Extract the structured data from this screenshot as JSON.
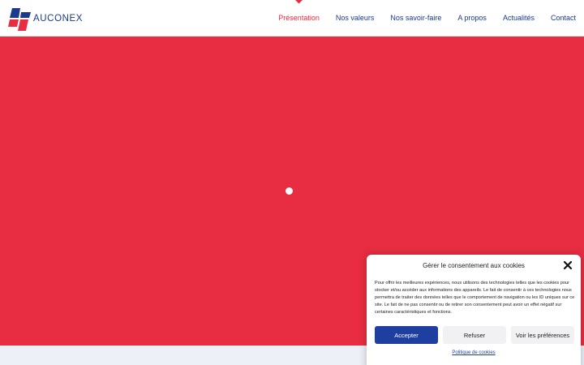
{
  "brand": {
    "name": "AUCONEX",
    "logo_icon": "auconex-logo-icon",
    "primary": "#1b3a8c",
    "accent": "#e82d42"
  },
  "nav": {
    "items": [
      {
        "label": "Présentation",
        "active": true
      },
      {
        "label": "Nos valeurs",
        "active": false
      },
      {
        "label": "Nos savoir-faire",
        "active": false
      },
      {
        "label": "A propos",
        "active": false
      },
      {
        "label": "Actualités",
        "active": false
      },
      {
        "label": "Contact",
        "active": false
      }
    ]
  },
  "hero": {
    "background": "#e82d42",
    "loader_icon": "loading-dot-icon"
  },
  "cookie": {
    "title": "Gérer le consentement aux cookies",
    "close_icon": "close-icon",
    "body": "Pour offrir les meilleures expériences, nous utilisons des technologies telles que les cookies pour stocker et/ou accéder aux informations des appareils. Le fait de consentir à ces technologies nous permettra de traiter des données telles que le comportement de navigation ou les ID uniques sur ce site. Le fait de ne pas consentir ou de retirer son consentement peut avoir un effet négatif sur certaines caractéristiques et fonctions.",
    "accept_label": "Accepter",
    "refuse_label": "Refuser",
    "prefs_label": "Voir les préférences",
    "policy_link": "Politique de cookies"
  }
}
